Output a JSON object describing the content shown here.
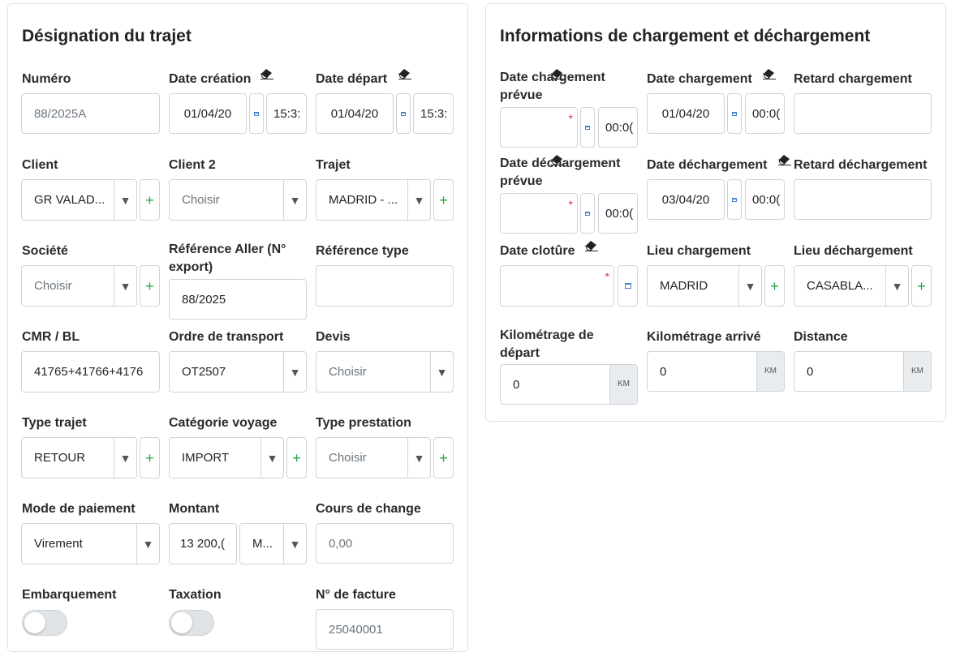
{
  "left": {
    "title": "Désignation du trajet",
    "numero": {
      "label": "Numéro",
      "value": "88/2025A"
    },
    "date_creation": {
      "label": "Date création",
      "date": "01/04/20",
      "time": "15:3:"
    },
    "date_depart": {
      "label": "Date départ",
      "date": "01/04/20",
      "time": "15:3:"
    },
    "client": {
      "label": "Client",
      "value": "GR VALAD..."
    },
    "client2": {
      "label": "Client 2",
      "value": "Choisir"
    },
    "trajet": {
      "label": "Trajet",
      "value": "MADRID - ..."
    },
    "societe": {
      "label": "Société",
      "value": "Choisir"
    },
    "reference_aller": {
      "label_line1": "Référence Aller (N°",
      "label_line2": "export)",
      "value": "88/2025"
    },
    "reference_type": {
      "label": "Référence type",
      "value": ""
    },
    "cmr": {
      "label": "CMR / BL",
      "value": "41765+41766+4176"
    },
    "ordre_transport": {
      "label": "Ordre de transport",
      "value": "OT2507"
    },
    "devis": {
      "label": "Devis",
      "value": "Choisir"
    },
    "type_trajet": {
      "label": "Type trajet",
      "value": "RETOUR"
    },
    "categorie_voyage": {
      "label": "Catégorie voyage",
      "value": "IMPORT"
    },
    "type_prestation": {
      "label": "Type prestation",
      "value": "Choisir"
    },
    "mode_paiement": {
      "label": "Mode de paiement",
      "value": "Virement"
    },
    "montant": {
      "label": "Montant",
      "value": "13 200,(",
      "currency": "M..."
    },
    "cours_change": {
      "label": "Cours de change",
      "value": "0,00"
    },
    "embarquement": {
      "label": "Embarquement"
    },
    "taxation": {
      "label": "Taxation"
    },
    "facture": {
      "label": "N° de facture",
      "value": "25040001"
    }
  },
  "right": {
    "title": "Informations de chargement et déchargement",
    "chargement_prevue": {
      "label_line1": "Date chargement",
      "label_line2": "prévue",
      "time": "00:0("
    },
    "date_chargement": {
      "label": "Date chargement",
      "date": "01/04/20",
      "time": "00:0("
    },
    "retard_chargement": {
      "label": "Retard chargement",
      "value": ""
    },
    "dechargement_prevue": {
      "label_line1": "Date déchargement",
      "label_line2": "prévue",
      "time": "00:0("
    },
    "date_dechargement": {
      "label": "Date déchargement",
      "date": "03/04/20",
      "time": "00:0("
    },
    "retard_dechargement": {
      "label": "Retard déchargement",
      "value": ""
    },
    "date_cloture": {
      "label": "Date clotûre"
    },
    "lieu_chargement": {
      "label": "Lieu chargement",
      "value": "MADRID"
    },
    "lieu_dechargement": {
      "label": "Lieu déchargement",
      "value": "CASABLA..."
    },
    "km_depart": {
      "label_line1": "Kilométrage de",
      "label_line2": "départ",
      "value": "0",
      "unit": "KM"
    },
    "km_arrive": {
      "label": "Kilométrage arrivé",
      "value": "0",
      "unit": "KM"
    },
    "distance": {
      "label": "Distance",
      "value": "0",
      "unit": "KM"
    }
  },
  "icons": {
    "select": "chevron-down-icon",
    "add": "plus-icon",
    "calendar": "calendar-icon",
    "clear": "eraser-icon",
    "required": "asterisk-icon"
  },
  "colors": {
    "add": "#28a745",
    "required": "#dc3545",
    "calendar": "#4a7fd0"
  }
}
